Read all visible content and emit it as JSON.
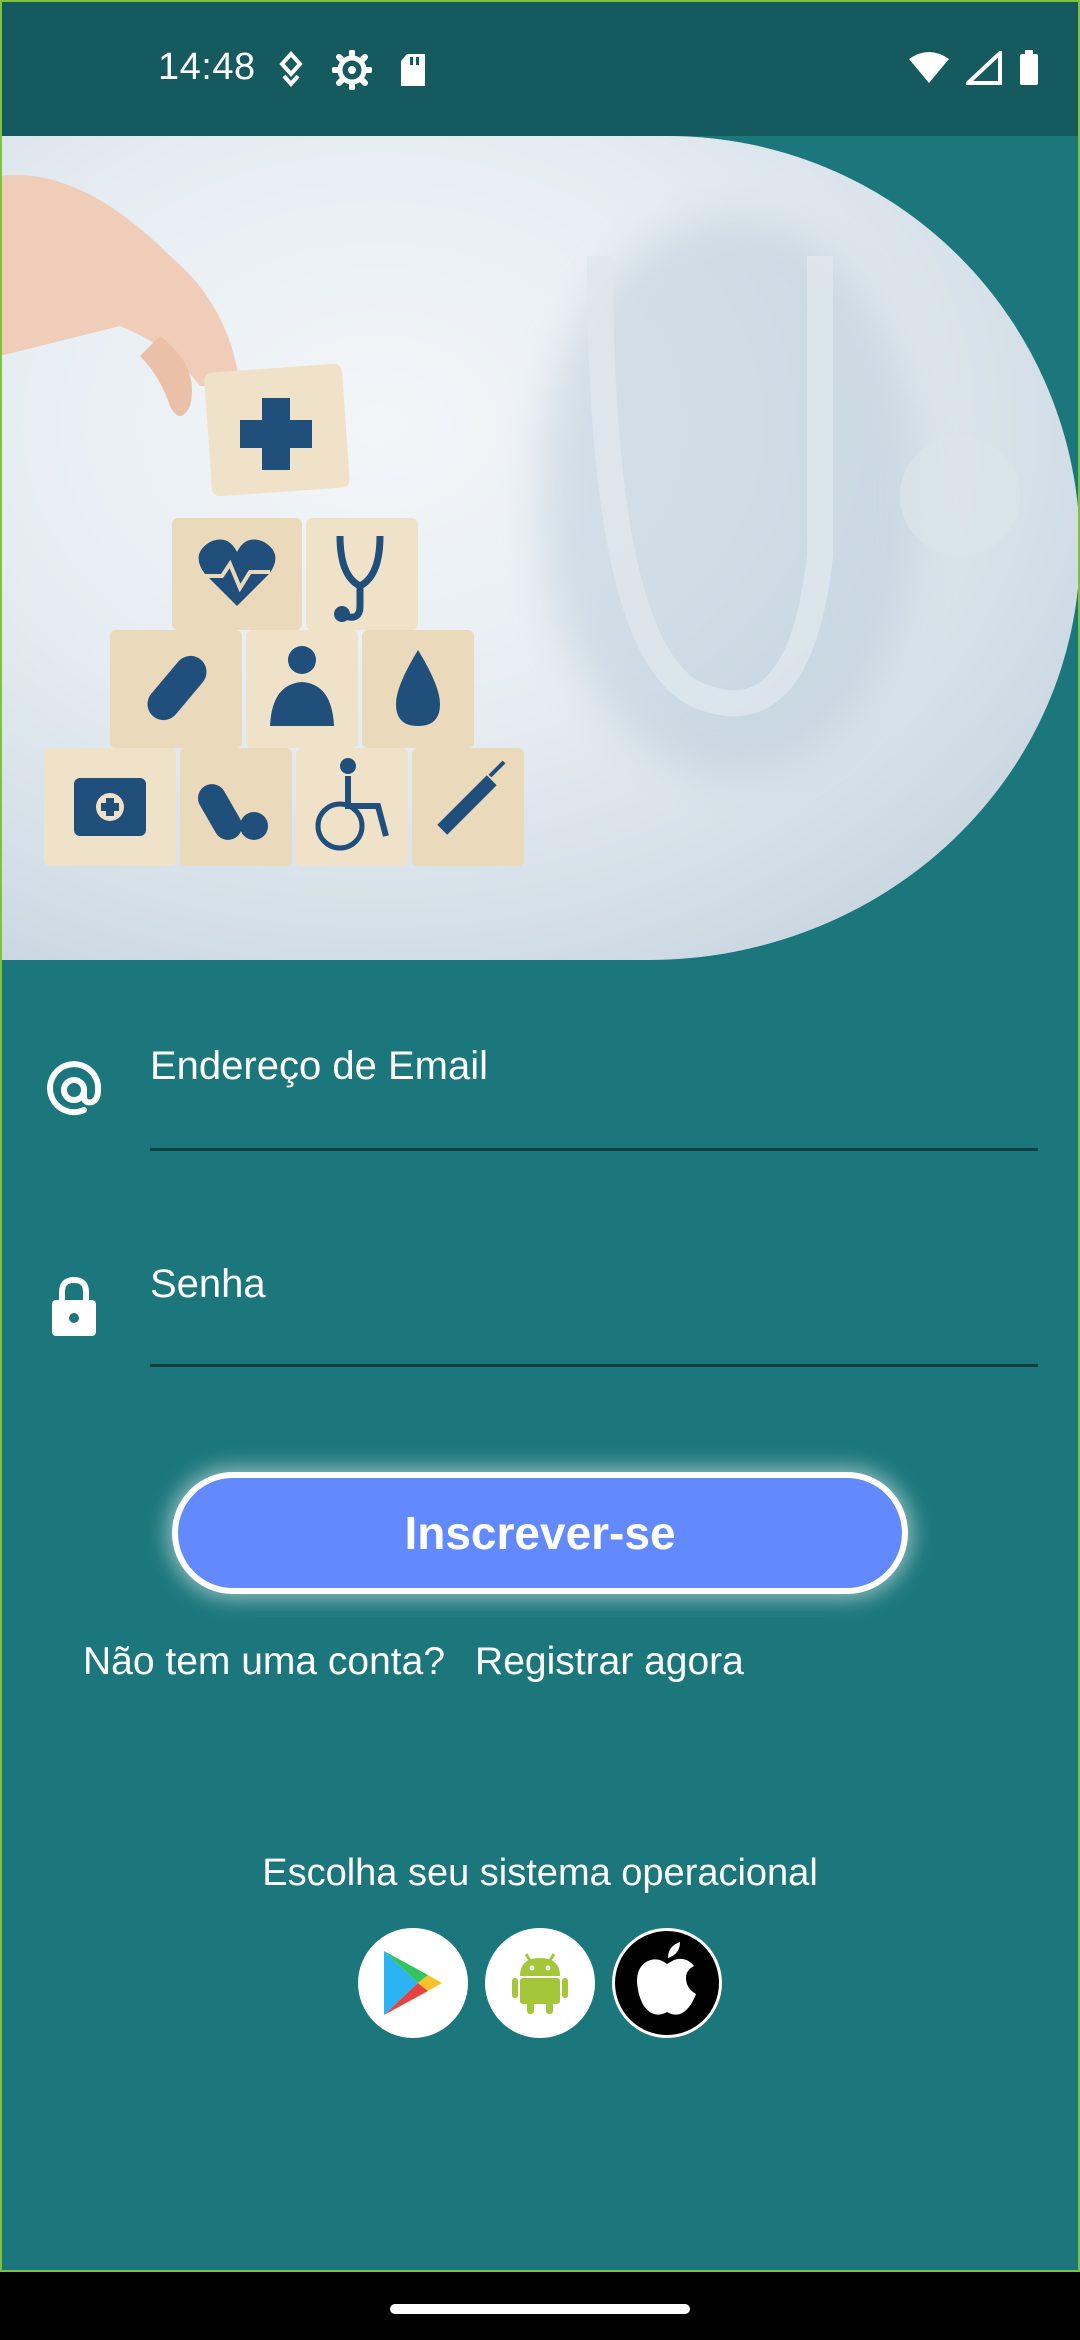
{
  "status_bar": {
    "time": "14:48",
    "left_icons": [
      "location-pin-icon",
      "settings-gear-icon",
      "sd-card-icon"
    ],
    "right_icons": [
      "wifi-icon",
      "cell-signal-icon",
      "battery-icon"
    ]
  },
  "hero": {
    "image": "medical-blocks-illustration"
  },
  "form": {
    "email_placeholder": "Endereço de Email",
    "email_icon": "at-sign-icon",
    "password_placeholder": "Senha",
    "password_icon": "lock-icon"
  },
  "login_button": {
    "label": "Inscrever-se"
  },
  "signup": {
    "question": "Não tem uma conta?",
    "link": "Registrar agora"
  },
  "os_choice": {
    "title": "Escolha seu sistema operacional",
    "options": [
      {
        "icon": "google-play-icon"
      },
      {
        "icon": "android-icon"
      },
      {
        "icon": "apple-icon"
      }
    ]
  },
  "colors": {
    "background": "#1b777c",
    "status_bar": "#155a5e",
    "button": "#6389ff",
    "underline": "#0f3f42"
  }
}
